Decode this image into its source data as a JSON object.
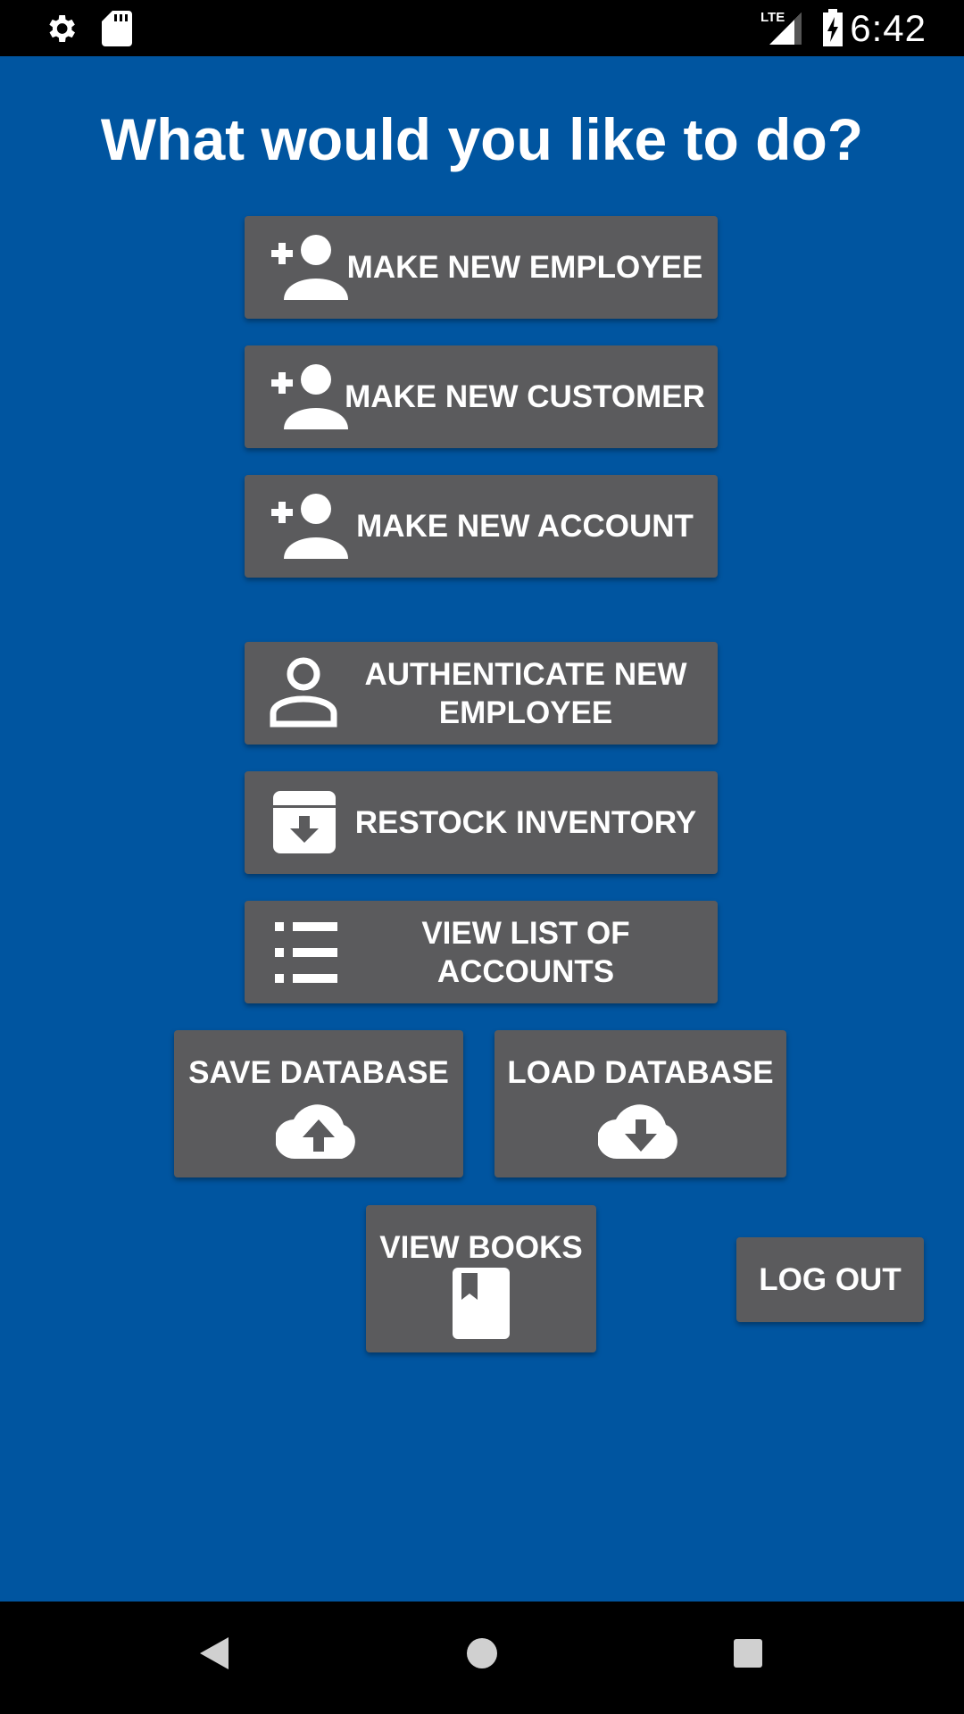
{
  "status_bar": {
    "time": "6:42",
    "network": "LTE",
    "icons": [
      "settings-icon",
      "sd-card-icon",
      "lte-signal-icon",
      "battery-charging-icon"
    ]
  },
  "title": "What would you like to do?",
  "buttons": {
    "make_employee": {
      "label": "MAKE NEW EMPLOYEE",
      "icon": "person-add-icon"
    },
    "make_customer": {
      "label": "MAKE NEW CUSTOMER",
      "icon": "person-add-icon"
    },
    "make_account": {
      "label": "MAKE NEW ACCOUNT",
      "icon": "person-add-icon"
    },
    "authenticate_employee": {
      "label": "AUTHENTICATE NEW EMPLOYEE",
      "icon": "person-outline-icon"
    },
    "restock_inventory": {
      "label": "RESTOCK INVENTORY",
      "icon": "archive-icon"
    },
    "view_accounts": {
      "label": "VIEW LIST OF ACCOUNTS",
      "icon": "list-icon"
    },
    "save_database": {
      "label": "SAVE DATABASE",
      "icon": "cloud-upload-icon"
    },
    "load_database": {
      "label": "LOAD DATABASE",
      "icon": "cloud-download-icon"
    },
    "view_books": {
      "label": "VIEW BOOKS",
      "icon": "book-icon"
    },
    "log_out": {
      "label": "LOG OUT"
    }
  },
  "nav_bar": {
    "icons": [
      "back-icon",
      "home-icon",
      "recents-icon"
    ]
  },
  "colors": {
    "background": "#0055a0",
    "button": "#5b5b5d",
    "text": "#ffffff",
    "system_bars": "#000000"
  }
}
